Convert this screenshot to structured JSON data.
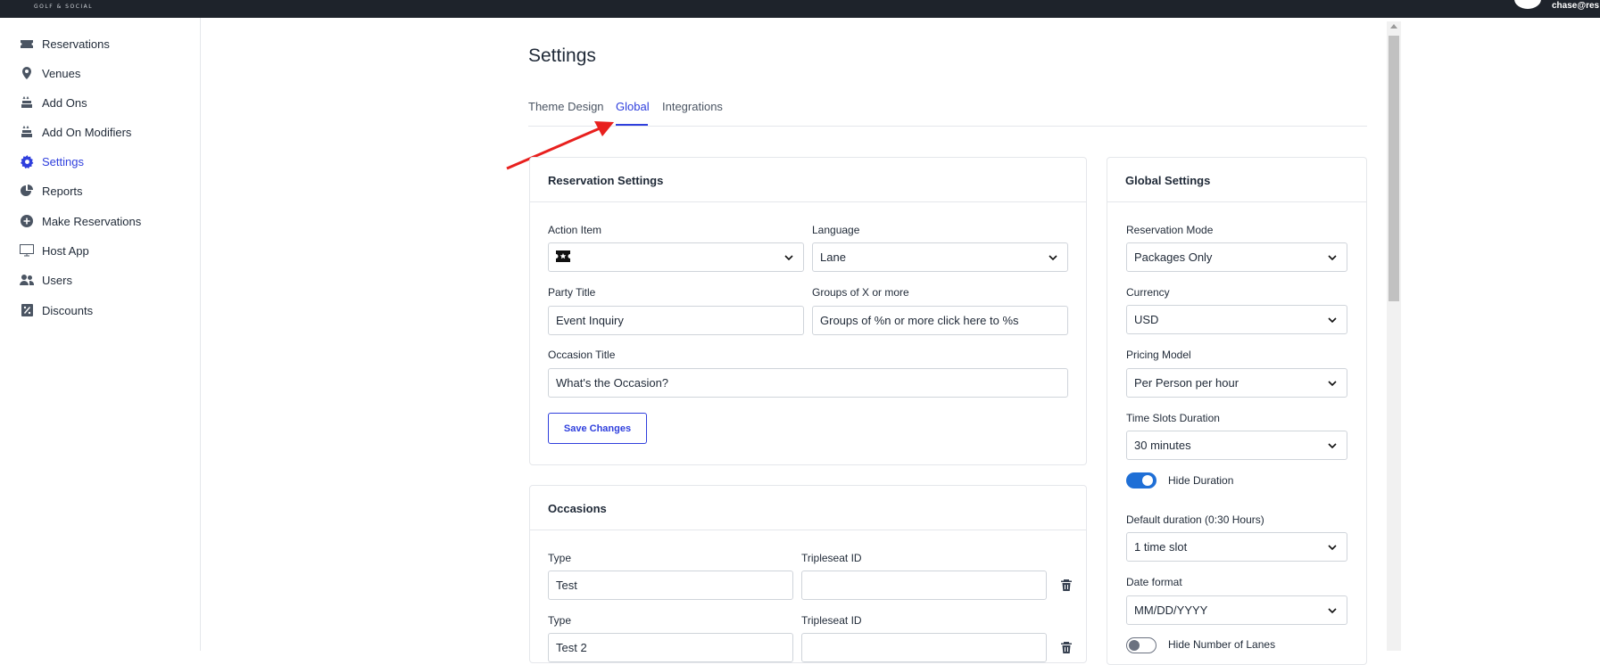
{
  "header": {
    "logo_text": "GOLF & SOCIAL",
    "user_email": "chase@res"
  },
  "sidebar": {
    "items": [
      {
        "label": "Reservations",
        "icon": "ticket-icon"
      },
      {
        "label": "Venues",
        "icon": "map-pin-icon"
      },
      {
        "label": "Add Ons",
        "icon": "cake-icon"
      },
      {
        "label": "Add On Modifiers",
        "icon": "cake-icon"
      },
      {
        "label": "Settings",
        "icon": "gear-icon",
        "active": true
      },
      {
        "label": "Reports",
        "icon": "pie-chart-icon"
      },
      {
        "label": "Make Reservations",
        "icon": "plus-circle-icon"
      },
      {
        "label": "Host App",
        "icon": "monitor-icon"
      },
      {
        "label": "Users",
        "icon": "users-icon"
      },
      {
        "label": "Discounts",
        "icon": "receipt-percent-icon"
      }
    ]
  },
  "page": {
    "title": "Settings",
    "tabs": [
      {
        "label": "Theme Design",
        "active": false
      },
      {
        "label": "Global",
        "active": true
      },
      {
        "label": "Integrations",
        "active": false
      }
    ]
  },
  "reservation_settings": {
    "title": "Reservation Settings",
    "action_item_label": "Action Item",
    "action_item_icon": "ticket-star-icon",
    "language_label": "Language",
    "language_value": "Lane",
    "party_title_label": "Party Title",
    "party_title_value": "Event Inquiry",
    "groups_label": "Groups of X or more",
    "groups_value": "Groups of %n or more click here to %s",
    "occasion_title_label": "Occasion Title",
    "occasion_title_value": "What's the Occasion?",
    "save_label": "Save Changes"
  },
  "occasions": {
    "title": "Occasions",
    "type_label": "Type",
    "tripleseat_label": "Tripleseat ID",
    "rows": [
      {
        "type": "Test",
        "tripleseat_id": ""
      },
      {
        "type": "Test 2",
        "tripleseat_id": ""
      }
    ]
  },
  "global_settings": {
    "title": "Global Settings",
    "reservation_mode_label": "Reservation Mode",
    "reservation_mode_value": "Packages Only",
    "currency_label": "Currency",
    "currency_value": "USD",
    "pricing_model_label": "Pricing Model",
    "pricing_model_value": "Per Person per hour",
    "time_slots_label": "Time Slots Duration",
    "time_slots_value": "30 minutes",
    "hide_duration_label": "Hide Duration",
    "hide_duration_on": true,
    "default_duration_label": "Default duration (0:30 Hours)",
    "default_duration_value": "1 time slot",
    "date_format_label": "Date format",
    "date_format_value": "MM/DD/YYYY",
    "hide_lanes_label": "Hide Number of Lanes",
    "hide_lanes_on": false
  },
  "colors": {
    "accent": "#2f3fdd",
    "toggle_on": "#1f6fd6",
    "topbar": "#1e232b",
    "annotation_arrow": "#e8201e"
  }
}
